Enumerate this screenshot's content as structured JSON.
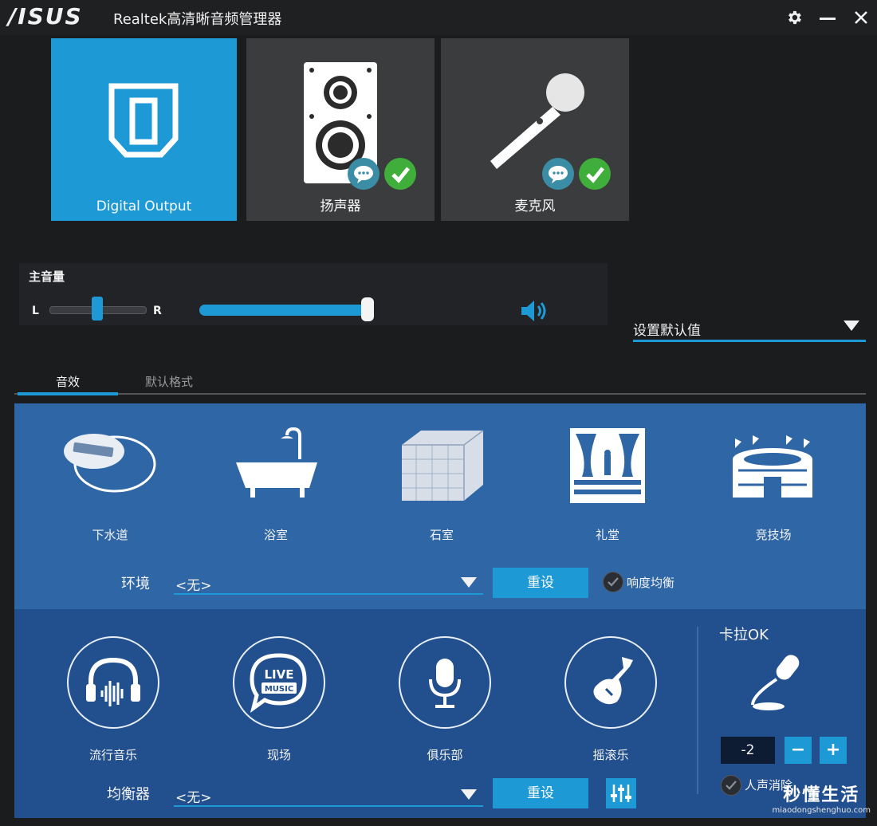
{
  "app": {
    "logo": "/ISUS",
    "title": "Realtek高清晰音频管理器"
  },
  "devices": [
    {
      "label": "Digital Output",
      "active": true
    },
    {
      "label": "扬声器",
      "active": false
    },
    {
      "label": "麦克风",
      "active": false
    }
  ],
  "volume": {
    "title": "主音量",
    "left_label": "L",
    "right_label": "R",
    "balance": 0.5,
    "level": 0.97
  },
  "defaults_dropdown": {
    "label": "设置默认值"
  },
  "tabs": [
    {
      "label": "音效",
      "active": true
    },
    {
      "label": "默认格式",
      "active": false
    }
  ],
  "environment": {
    "presets": [
      "下水道",
      "浴室",
      "石室",
      "礼堂",
      "竞技场"
    ],
    "label": "环境",
    "selected": "<无>",
    "reset_label": "重设",
    "loudness_label": "响度均衡"
  },
  "equalizer": {
    "presets": [
      "流行音乐",
      "现场",
      "俱乐部",
      "摇滚乐"
    ],
    "live_badge": "LIVE",
    "music_badge": "MUSIC",
    "label": "均衡器",
    "selected": "<无>",
    "reset_label": "重设"
  },
  "karaoke": {
    "title": "卡拉OK",
    "value": "-2",
    "minus": "−",
    "plus": "+",
    "vocal_cancel_label": "人声消除"
  },
  "watermark": {
    "main": "秒懂生活",
    "sub": "miaodongshenghuo.com"
  },
  "colors": {
    "accent": "#1d9ad6",
    "env_panel": "#2f67a6",
    "eq_panel": "#22508e",
    "background": "#1b1c1e",
    "check_green": "#3fae3a"
  },
  "icons": {
    "settings": "gear-icon",
    "minimize": "minimize-icon",
    "close": "close-icon",
    "speaker_volume": "speaker-volume-icon"
  }
}
